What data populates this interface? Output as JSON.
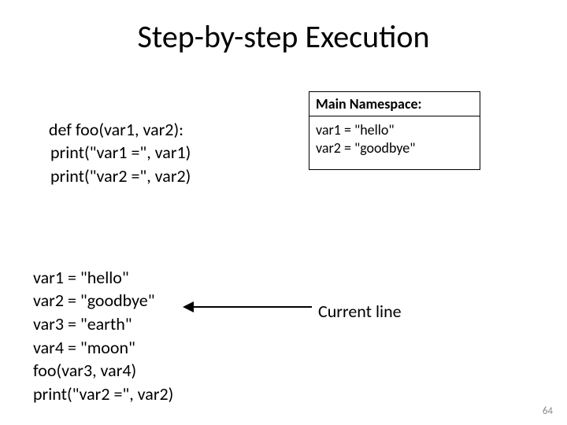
{
  "title": "Step-by-step Execution",
  "code_top": {
    "line1": "def foo(var1, var2):",
    "line2": "print(\"var1 =\", var1)",
    "line3": "print(\"var2 =\", var2)"
  },
  "code_bottom": {
    "line1": "var1 = \"hello\"",
    "line2": "var2 = \"goodbye\"",
    "line3": "var3 = \"earth\"",
    "line4": "var4 = \"moon\"",
    "line5": "foo(var3, var4)",
    "line6": "print(\"var2 =\", var2)"
  },
  "namespace": {
    "header": "Main Namespace:",
    "entries": [
      "var1 = \"hello\"",
      "var2 = \"goodbye\""
    ]
  },
  "current_line_label": "Current line",
  "page_number": "64"
}
